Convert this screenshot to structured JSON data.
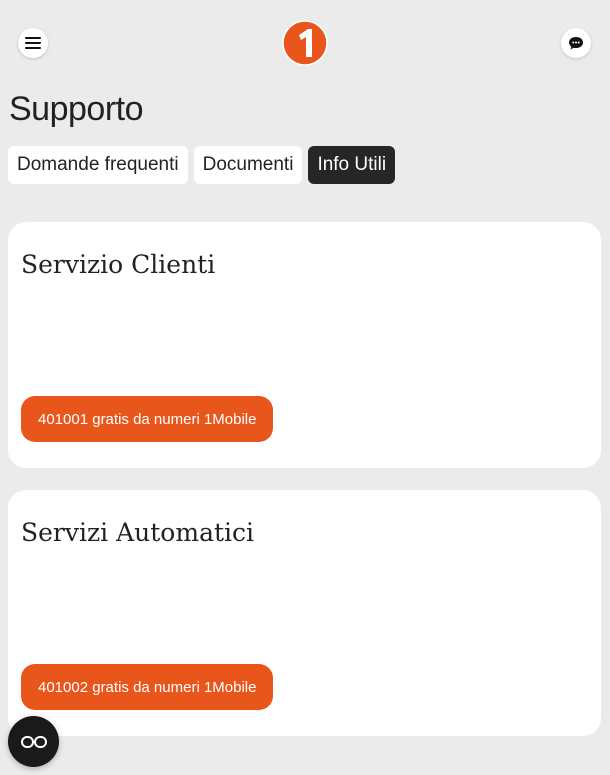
{
  "header": {
    "menu_icon": "hamburger-menu-icon",
    "logo_icon": "brand-logo-1-icon",
    "chat_icon": "chat-bubble-icon",
    "brand_color": "#e9561c"
  },
  "page": {
    "title": "Supporto"
  },
  "tabs": [
    {
      "label": "Domande frequenti",
      "active": false
    },
    {
      "label": "Documenti",
      "active": false
    },
    {
      "label": "Info Utili",
      "active": true
    }
  ],
  "cards": [
    {
      "title": "Servizio Clienti",
      "button_label": "401001 gratis da numeri 1Mobile"
    },
    {
      "title": "Servizi Automatici",
      "button_label": "401002 gratis da numeri 1Mobile"
    }
  ],
  "fab": {
    "icon": "glasses-accessibility-icon"
  },
  "colors": {
    "background": "#ebebeb",
    "card": "#ffffff",
    "active_tab": "#262626",
    "accent": "#e9561c"
  }
}
